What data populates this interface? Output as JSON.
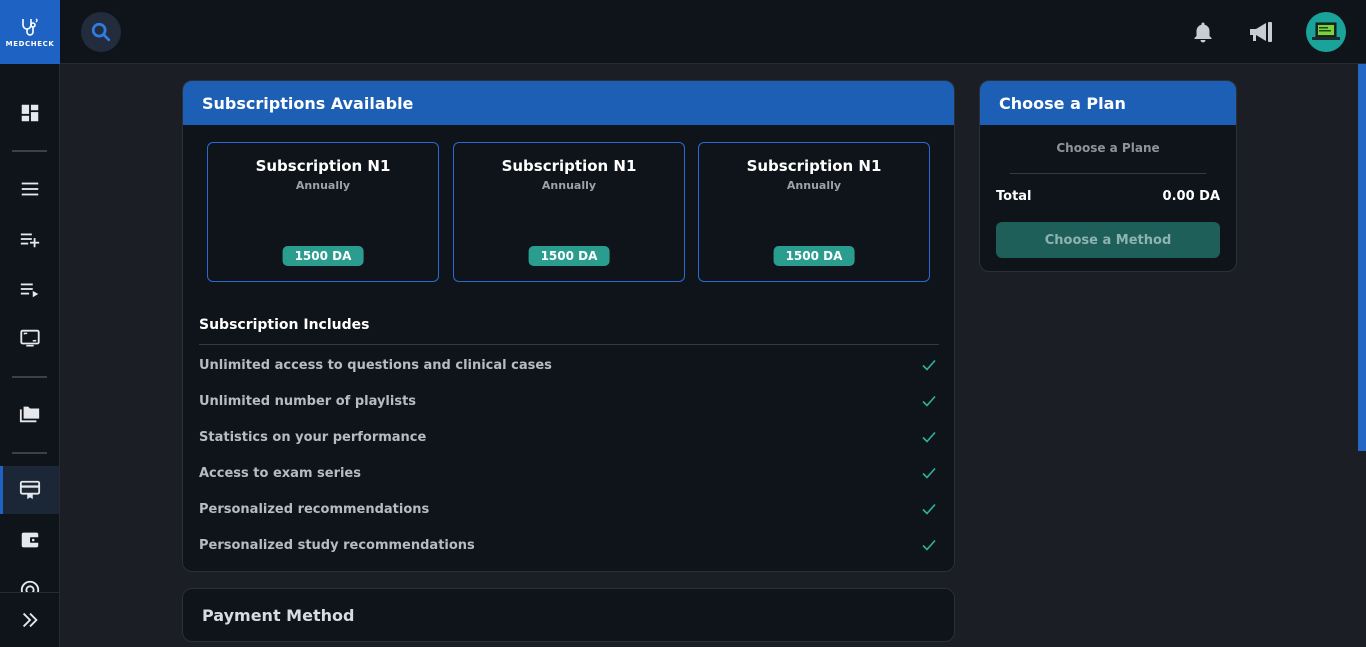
{
  "app": {
    "logo_text": "MEDCHECK"
  },
  "sidebar": {
    "items": [
      {
        "name": "dashboard-icon"
      },
      {
        "name": "menu-list-icon"
      },
      {
        "name": "playlist-add-icon"
      },
      {
        "name": "playlist-play-icon"
      },
      {
        "name": "screen-icon"
      },
      {
        "name": "folders-icon"
      },
      {
        "name": "subscription-card-icon",
        "active": true
      },
      {
        "name": "wallet-icon"
      },
      {
        "name": "target-icon"
      }
    ],
    "expand_icon": "double-chevron-right-icon"
  },
  "topbar": {
    "search_icon": "search-icon",
    "notifications_icon": "bell-icon",
    "announcements_icon": "megaphone-icon",
    "avatar_icon": "user-avatar"
  },
  "subscriptions": {
    "header": "Subscriptions Available",
    "plans": [
      {
        "title": "Subscription N1",
        "period": "Annually",
        "price": "1500 DA"
      },
      {
        "title": "Subscription N1",
        "period": "Annually",
        "price": "1500 DA"
      },
      {
        "title": "Subscription N1",
        "period": "Annually",
        "price": "1500 DA"
      }
    ],
    "includes_title": "Subscription Includes",
    "features": [
      "Unlimited access to questions and clinical cases",
      "Unlimited number of playlists",
      "Statistics on your performance",
      "Access to exam series",
      "Personalized recommendations",
      "Personalized study recommendations"
    ]
  },
  "payment": {
    "header": "Payment Method"
  },
  "choose_plan": {
    "header": "Choose a Plan",
    "subtitle": "Choose a Plane",
    "total_label": "Total",
    "total_value": "0.00 DA",
    "method_button": "Choose a Method"
  },
  "colors": {
    "accent": "#1e5fb6",
    "price_badge": "#2a9d8f",
    "check": "#2fb39f",
    "background": "#1b1e24",
    "panel": "#0f141b"
  }
}
